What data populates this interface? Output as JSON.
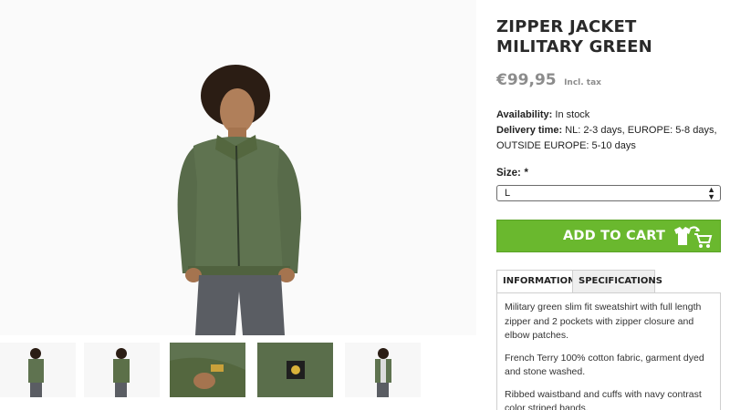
{
  "product": {
    "title": "ZIPPER JACKET MILITARY GREEN",
    "price": "€99,95",
    "tax_note": "Incl. tax"
  },
  "availability": {
    "label": "Availability:",
    "value": "In stock"
  },
  "delivery": {
    "label": "Delivery time:",
    "value": "NL: 2-3 days, EUROPE: 5-8 days, OUTSIDE EUROPE: 5-10 days"
  },
  "size": {
    "label": "Size:",
    "required_mark": "*",
    "selected": "L"
  },
  "cart": {
    "button_label": "ADD TO CART",
    "icon": "shirt-cart-icon"
  },
  "tabs": [
    {
      "label": "INFORMATION",
      "active": true
    },
    {
      "label": "SPECIFICATIONS",
      "active": false
    }
  ],
  "information": {
    "paragraphs": [
      "Military green slim fit sweatshirt with full length zipper and 2 pockets with zipper closure and elbow patches.",
      "French Terry 100% cotton fabric, garment dyed and stone washed.",
      "Ribbed waistband and cuffs with navy contrast color striped bands."
    ]
  },
  "colors": {
    "accent_green": "#6ab82e",
    "jacket_green": "#5f7350",
    "price_grey": "#8c8c8c"
  }
}
